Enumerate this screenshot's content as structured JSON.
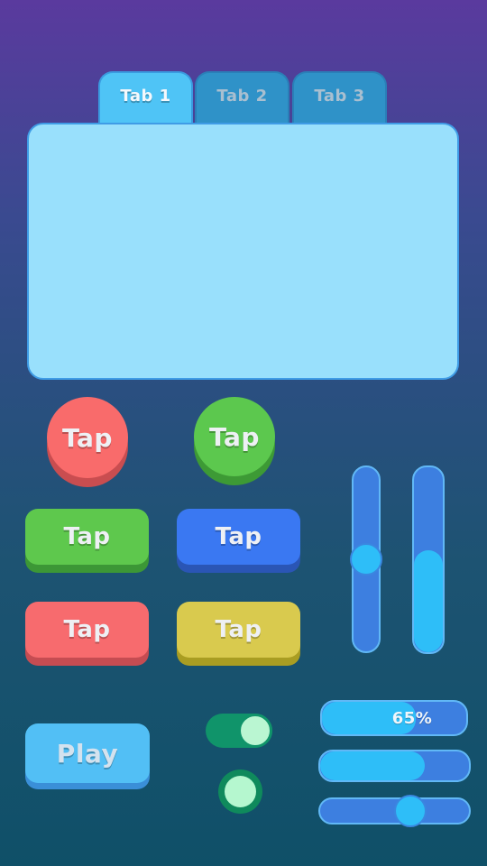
{
  "tabs": [
    {
      "label": "Tab 1",
      "active": true
    },
    {
      "label": "Tab 2",
      "active": false
    },
    {
      "label": "Tab 3",
      "active": false
    }
  ],
  "buttons": {
    "round_red": "Tap",
    "round_green": "Tap",
    "green": "Tap",
    "blue": "Tap",
    "red": "Tap",
    "yellow": "Tap",
    "play": "Play"
  },
  "sliders": {
    "vertical_left_level": 0.5,
    "vertical_right_fill": 0.55,
    "progress_percent_label": "65%",
    "progress_percent": 65,
    "bar_fill": 0.7,
    "horizontal_slider_level": 0.63
  },
  "toggle": {
    "on": true
  },
  "radio": {
    "selected": true
  },
  "colors": {
    "tab_active": "#4fc4f6",
    "tab_inactive": "#2f92c8",
    "panel": "#99e0fc",
    "red": "#f96b6b",
    "green": "#5cc84e",
    "blue": "#3a78f2",
    "yellow": "#d9ca4e",
    "toggle_on": "#10946a"
  }
}
